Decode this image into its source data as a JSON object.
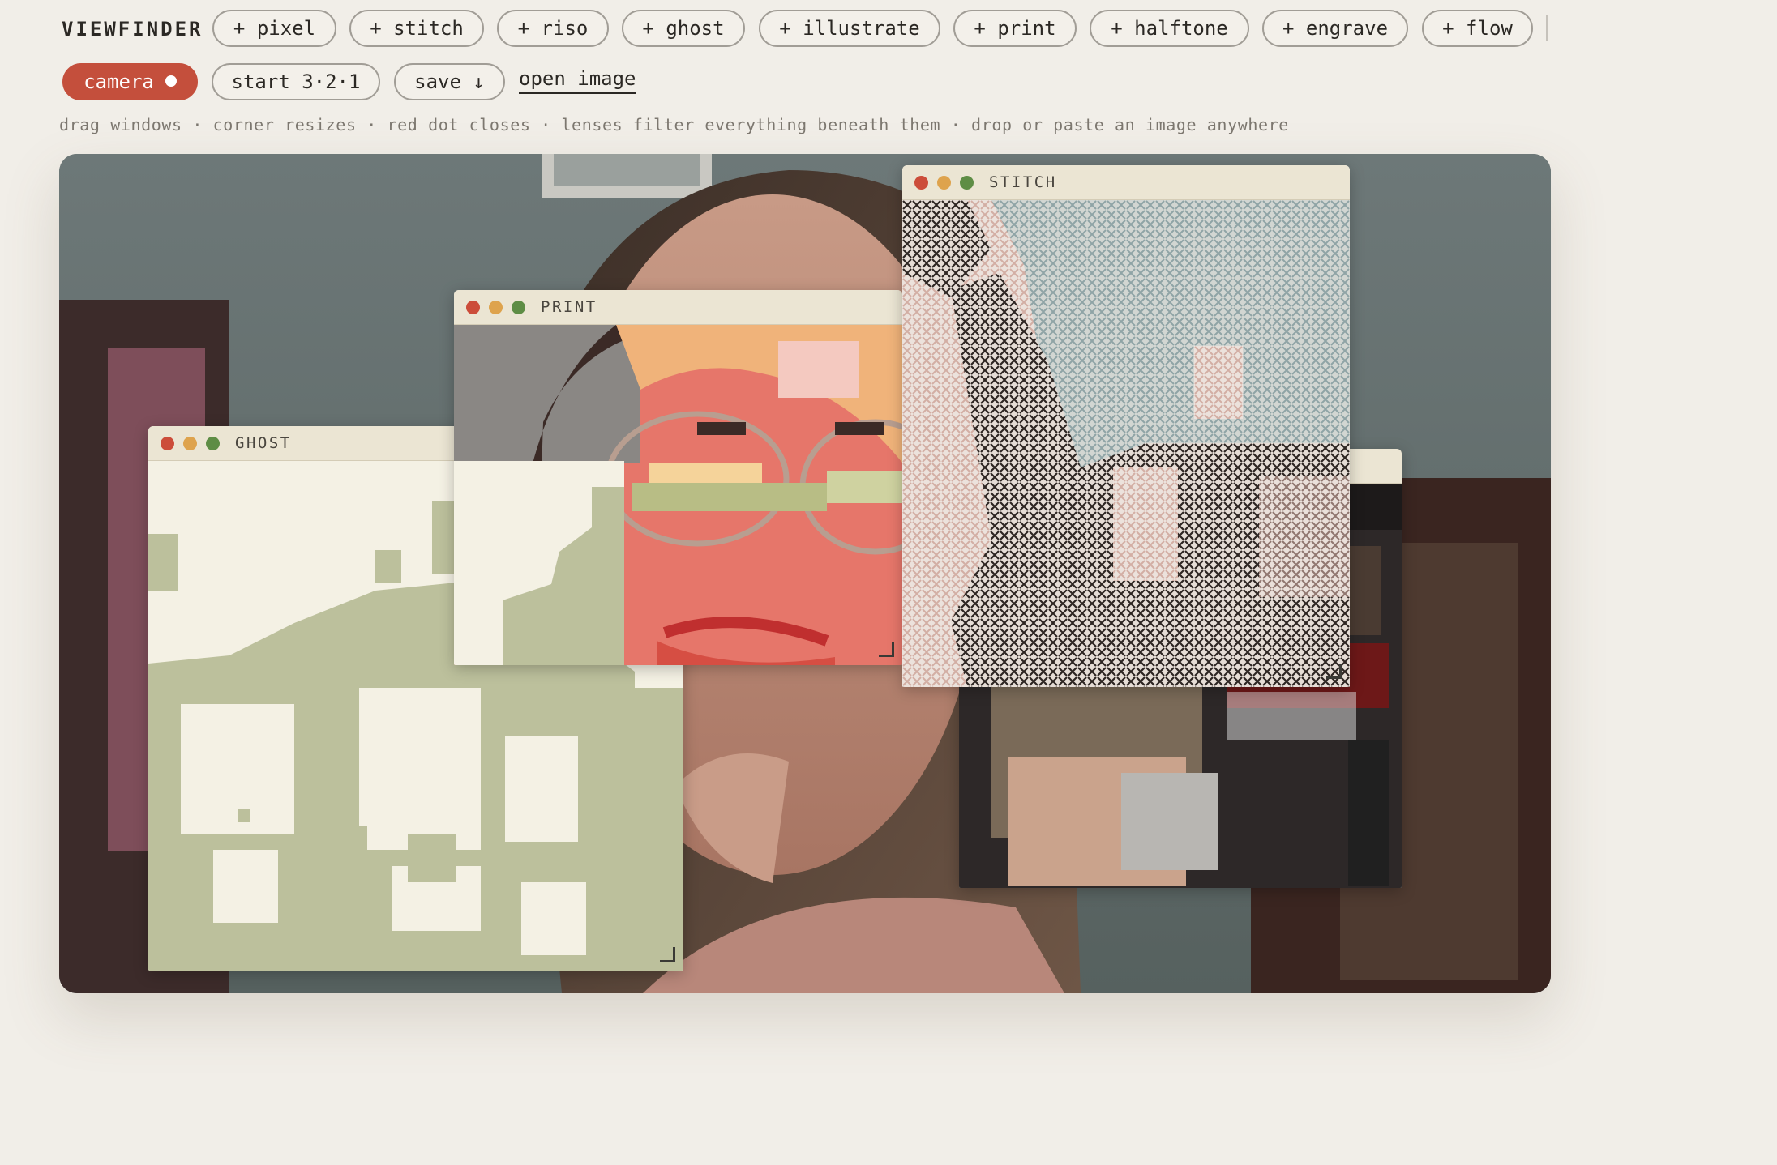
{
  "brand": "VIEWFINDER",
  "lens_buttons": [
    "+ pixel",
    "+ stitch",
    "+ riso",
    "+ ghost",
    "+ illustrate",
    "+ print",
    "+ halftone",
    "+ engrave",
    "+ flow"
  ],
  "controls": {
    "camera_label": "camera",
    "start_label": "start 3·2·1",
    "save_label": "save ↓",
    "open_label": "open image"
  },
  "hint": "drag windows · corner resizes · red dot closes · lenses filter everything beneath them · drop or paste an image anywhere",
  "windows": {
    "ghost": "GHOST",
    "print": "PRINT",
    "stitch": "STITCH"
  },
  "colors": {
    "accent_red": "#c44f3c",
    "close_dot": "#cc4d3a",
    "minimize_dot": "#dea34d",
    "zoom_dot": "#5e8d45",
    "background": "#f1eee8"
  }
}
